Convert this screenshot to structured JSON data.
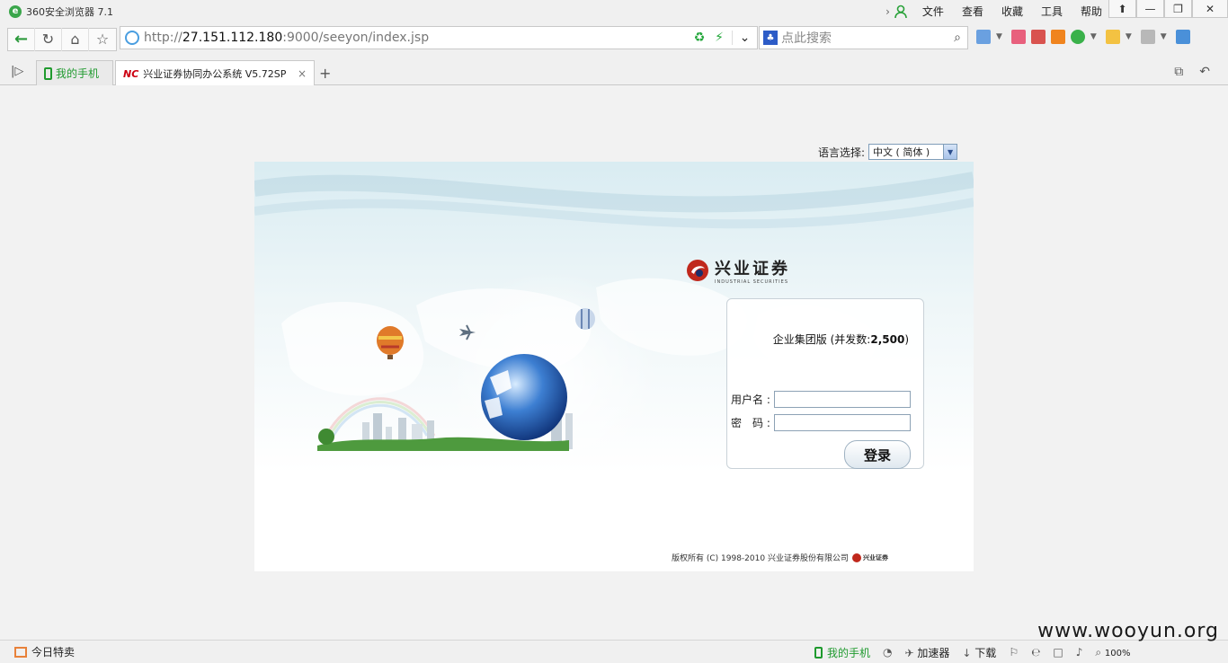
{
  "browser": {
    "logo_letter": "e",
    "title": "360安全浏览器 7.1",
    "menu": [
      "文件",
      "查看",
      "收藏",
      "工具",
      "帮助"
    ],
    "window_controls": [
      "⬆",
      "—",
      "❐",
      "✕"
    ],
    "url_scheme": "http://",
    "url_host": "27.151.112.180",
    "url_path": ":9000/seeyon/index.jsp",
    "search_placeholder": "点此搜索",
    "tabs": [
      {
        "label": "我的手机"
      },
      {
        "label": "兴业证券协同办公系统 V5.72SP",
        "close": "×"
      }
    ],
    "new_tab": "+"
  },
  "page": {
    "language_label": "语言选择:",
    "language_value": "中文 ( 简体 )",
    "brand_cn": "兴业证券",
    "brand_en": "INDUSTRIAL SECURITIES",
    "edition_prefix": "企业集团版 (并发数:",
    "edition_count": "2,500",
    "edition_suffix": ")",
    "username_label": "用户名 :",
    "password_label": "密　码 :",
    "username_value": "",
    "password_value": "",
    "login_button": "登录",
    "copyright": "版权所有 (C) 1998-2010  兴业证券股份有限公司",
    "copyright_brand": "兴业证券"
  },
  "statusbar": {
    "today_deal": "今日特卖",
    "my_phone": "我的手机",
    "accelerator": "加速器",
    "download": "下载",
    "zoom": "100%"
  },
  "watermark": "www.wooyun.org",
  "colors": {
    "accent_green": "#1f9a2e",
    "brand_red": "#c0281c",
    "globe_blue": "#2b5fb4"
  }
}
